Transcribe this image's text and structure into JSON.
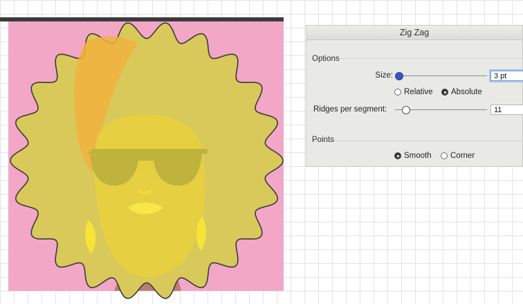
{
  "dialog": {
    "title": "Zig Zag",
    "options_group_label": "Options",
    "size": {
      "label": "Size:",
      "value": "3 pt",
      "slider_level": 0.0
    },
    "mode_radios": [
      {
        "label": "Relative",
        "selected": false
      },
      {
        "label": "Absolute",
        "selected": true
      }
    ],
    "ridges": {
      "label": "Ridges per segment:",
      "value": "11",
      "slider_level": 0.11
    },
    "points_group_label": "Points",
    "points_radios": [
      {
        "label": "Smooth",
        "selected": true
      },
      {
        "label": "Corner",
        "selected": false
      }
    ]
  },
  "colors": {
    "canvas_background": "#f2a7c7",
    "hair_wavy": "#d9c95a",
    "hair_highlight": "#f0b33f",
    "skin": "#e7cf3e",
    "sunglasses": "#bfb23d",
    "earring": "#f7e437",
    "slider_accent": "#3a52c8",
    "grid": "#e3e3e3"
  },
  "icons": [
    "radio-button",
    "slider-knob"
  ]
}
